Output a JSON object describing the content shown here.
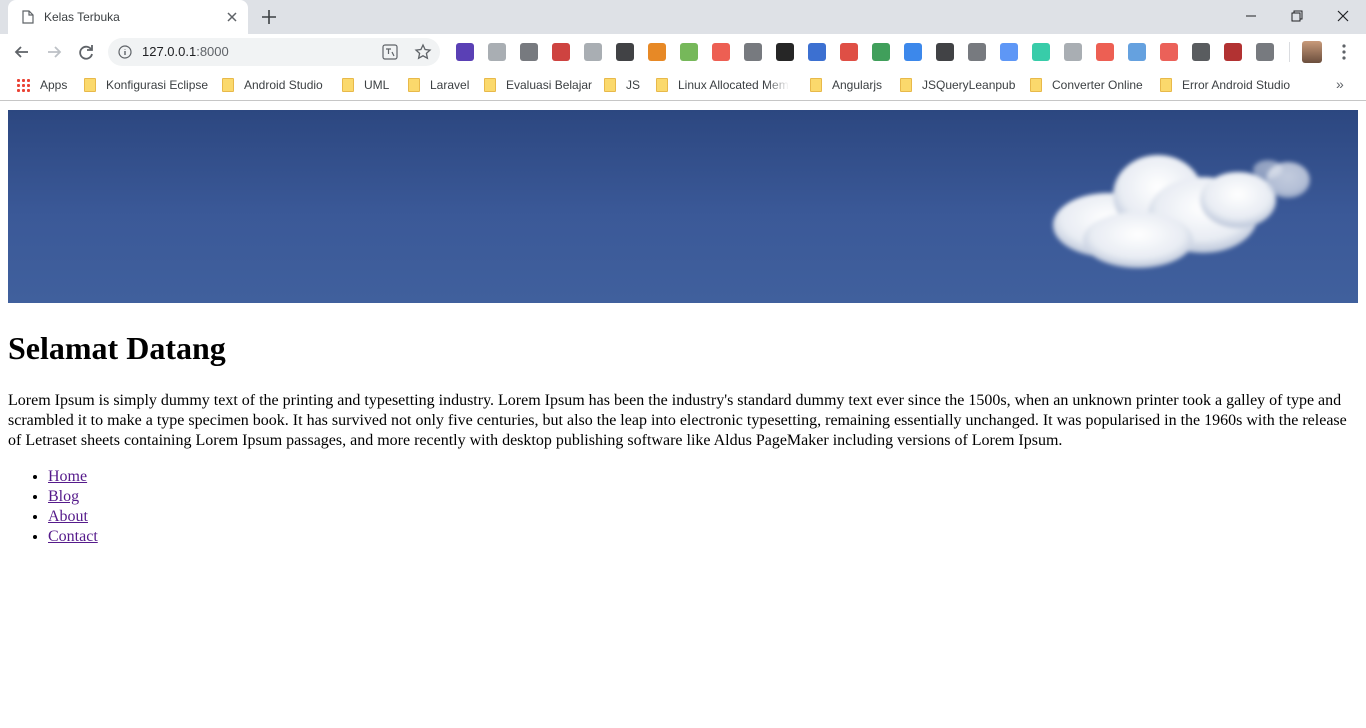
{
  "browser": {
    "tab": {
      "title": "Kelas Terbuka"
    },
    "address": {
      "host": "127.0.0.1",
      "port": ":8000"
    },
    "bookmarks": [
      {
        "label": "Apps",
        "type": "apps"
      },
      {
        "label": "Konfigurasi Eclipse",
        "type": "folder"
      },
      {
        "label": "Android Studio",
        "type": "folder"
      },
      {
        "label": "UML",
        "type": "folder"
      },
      {
        "label": "Laravel",
        "type": "folder"
      },
      {
        "label": "Evaluasi Belajar",
        "type": "folder"
      },
      {
        "label": "JS",
        "type": "folder"
      },
      {
        "label": "Linux Allocated Mem",
        "type": "folder"
      },
      {
        "label": "Angularjs",
        "type": "folder"
      },
      {
        "label": "JSQueryLeanpub",
        "type": "folder"
      },
      {
        "label": "Converter Online",
        "type": "folder"
      },
      {
        "label": "Error Android Studio",
        "type": "folder"
      }
    ],
    "bookmarks_more": "»",
    "extensions": [
      {
        "name": "layers-extension-icon",
        "color": "#3d1fa8"
      },
      {
        "name": "cloud-save-extension-icon",
        "color": "#9aa0a6"
      },
      {
        "name": "code-extension-icon",
        "color": "#5f6368"
      },
      {
        "name": "ublock-extension-icon",
        "color": "#c5221f"
      },
      {
        "name": "stats-extension-icon",
        "color": "#9aa0a6"
      },
      {
        "name": "sync-extension-icon",
        "color": "#202124"
      },
      {
        "name": "download-extension-icon",
        "color": "#e37400"
      },
      {
        "name": "print-extension-icon",
        "color": "#5eab3d"
      },
      {
        "name": "pdf-extension-icon",
        "color": "#ea4335"
      },
      {
        "name": "film-extension-icon",
        "color": "#5f6368"
      },
      {
        "name": "jb-extension-icon",
        "color": "#000000"
      },
      {
        "name": "info-extension-icon",
        "color": "#1a57c9"
      },
      {
        "name": "adblock-plus-extension-icon",
        "color": "#d93025"
      },
      {
        "name": "globe-extension-icon",
        "color": "#1e8e3e"
      },
      {
        "name": "vuejs-extension-icon",
        "color": "#1a73e8"
      },
      {
        "name": "json-extension-icon",
        "color": "#202124"
      },
      {
        "name": "lightbulb-extension-icon",
        "color": "#5f6368"
      },
      {
        "name": "translate-extension-icon",
        "color": "#4285f4"
      },
      {
        "name": "grammarly-extension-icon",
        "color": "#15c39a"
      },
      {
        "name": "image-extension-icon",
        "color": "#9aa0a6"
      },
      {
        "name": "record-extension-icon",
        "color": "#ea4335"
      },
      {
        "name": "wave-extension-icon",
        "color": "#4a90d9"
      },
      {
        "name": "screenshot-extension-icon",
        "color": "#e8453c"
      },
      {
        "name": "cow-extension-icon",
        "color": "#3c4043"
      },
      {
        "name": "metro-extension-icon",
        "color": "#a50e0e"
      },
      {
        "name": "gear-extension-icon",
        "color": "#5f6368"
      }
    ]
  },
  "page": {
    "title": "Selamat Datang",
    "body": "Lorem Ipsum is simply dummy text of the printing and typesetting industry. Lorem Ipsum has been the industry's standard dummy text ever since the 1500s, when an unknown printer took a galley of type and scrambled it to make a type specimen book. It has survived not only five centuries, but also the leap into electronic typesetting, remaining essentially unchanged. It was popularised in the 1960s with the release of Letraset sheets containing Lorem Ipsum passages, and more recently with desktop publishing software like Aldus PageMaker including versions of Lorem Ipsum.",
    "nav": [
      {
        "label": "Home"
      },
      {
        "label": "Blog"
      },
      {
        "label": "About"
      },
      {
        "label": "Contact"
      }
    ]
  },
  "colors": {
    "banner": "#3b5998",
    "link_visited": "#551a8b",
    "chrome_frame": "#dee1e6"
  }
}
